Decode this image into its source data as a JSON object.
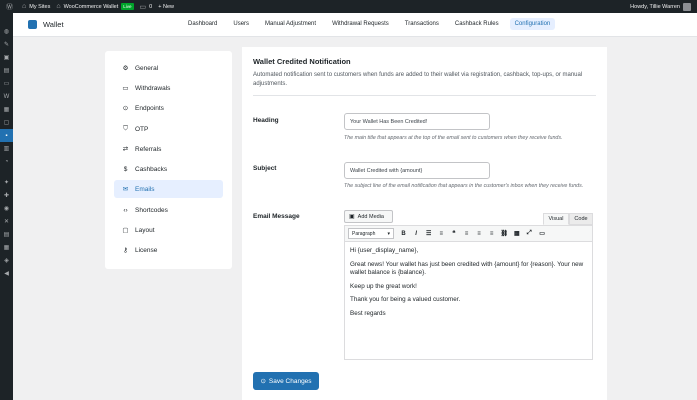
{
  "admin_bar": {
    "my_sites": "My Sites",
    "site_name": "WooCommerce Wallet",
    "live_badge": "Live",
    "comments_count": "0",
    "new_label": "+ New",
    "howdy": "Howdy, Tillie Warren"
  },
  "header": {
    "title": "Wallet",
    "tabs": [
      {
        "label": "Dashboard"
      },
      {
        "label": "Users"
      },
      {
        "label": "Manual Adjustment"
      },
      {
        "label": "Withdrawal Requests"
      },
      {
        "label": "Transactions"
      },
      {
        "label": "Cashback Rules"
      },
      {
        "label": "Configuration",
        "active": true
      }
    ]
  },
  "sidebar": {
    "items": [
      {
        "label": "General",
        "icon": "gear-icon"
      },
      {
        "label": "Withdrawals",
        "icon": "card-icon"
      },
      {
        "label": "Endpoints",
        "icon": "pin-icon"
      },
      {
        "label": "OTP",
        "icon": "shield-icon"
      },
      {
        "label": "Referrals",
        "icon": "referral-icon"
      },
      {
        "label": "Cashbacks",
        "icon": "dollar-icon"
      },
      {
        "label": "Emails",
        "icon": "mail-icon",
        "active": true
      },
      {
        "label": "Shortcodes",
        "icon": "code-icon"
      },
      {
        "label": "Layout",
        "icon": "layout-icon"
      },
      {
        "label": "License",
        "icon": "key-icon"
      }
    ]
  },
  "panel": {
    "title": "Wallet Credited Notification",
    "description": "Automated notification sent to customers when funds are added to their wallet via registration, cashback, top-ups, or manual adjustments.",
    "heading": {
      "label": "Heading",
      "value": "Your Wallet Has Been Credited!",
      "help": "The main title that appears at the top of the email sent to customers when they receive funds."
    },
    "subject": {
      "label": "Subject",
      "value": "Wallet Credited with {amount}",
      "help": "The subject line of the email notification that appears in the customer's inbox when they receive funds."
    },
    "message": {
      "label": "Email Message",
      "add_media": "Add Media",
      "tab_visual": "Visual",
      "tab_code": "Code",
      "format_select": "Paragraph",
      "paragraphs": [
        "Hi {user_display_name},",
        "Great news! Your wallet has just been credited with {amount} for {reason}. Your new wallet balance is {balance}.",
        "Keep up the great work!",
        "Thank you for being a valued customer.",
        "Best regards"
      ]
    },
    "save_label": "Save Changes"
  },
  "colors": {
    "accent": "#2271b1",
    "accent_light": "#e6efff",
    "admin_dark": "#1d2327",
    "live_green": "#00a32a"
  }
}
